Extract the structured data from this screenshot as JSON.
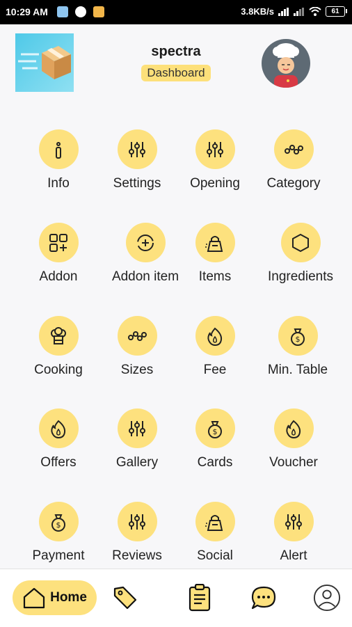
{
  "status_bar": {
    "time": "10:29 AM",
    "network_speed": "3.8KB/s",
    "battery": "61"
  },
  "header": {
    "shop_name": "spectra",
    "badge": "Dashboard",
    "logo_icon": "delivery-box-icon",
    "avatar_icon": "chef-avatar-icon"
  },
  "colors": {
    "accent": "#fde17e",
    "text": "#222222",
    "background": "#f7f7f9"
  },
  "menu": [
    {
      "label": "Info",
      "icon": "info-icon"
    },
    {
      "label": "Settings",
      "icon": "sliders-icon"
    },
    {
      "label": "Opening",
      "icon": "sliders-icon"
    },
    {
      "label": "Category",
      "icon": "nodes-icon"
    },
    {
      "label": "Addon",
      "icon": "grid-plus-icon"
    },
    {
      "label": "Addon item",
      "icon": "dashed-plus-circle-icon"
    },
    {
      "label": "Items",
      "icon": "shopping-bag-icon"
    },
    {
      "label": "Ingredients",
      "icon": "hexagon-icon"
    },
    {
      "label": "Cooking",
      "icon": "chef-hat-icon"
    },
    {
      "label": "Sizes",
      "icon": "nodes-icon"
    },
    {
      "label": "Fee",
      "icon": "flame-icon"
    },
    {
      "label": "Min. Table",
      "icon": "money-bag-icon"
    },
    {
      "label": "Offers",
      "icon": "flame-icon"
    },
    {
      "label": "Gallery",
      "icon": "sliders-icon"
    },
    {
      "label": "Cards",
      "icon": "money-bag-icon"
    },
    {
      "label": "Voucher",
      "icon": "flame-icon"
    },
    {
      "label": "Payment",
      "icon": "money-bag-icon"
    },
    {
      "label": "Reviews",
      "icon": "sliders-icon"
    },
    {
      "label": "Social",
      "icon": "shopping-bag-icon"
    },
    {
      "label": "Alert",
      "icon": "sliders-icon"
    }
  ],
  "bottom_nav": {
    "home_label": "Home",
    "items": [
      "home-icon",
      "tag-icon",
      "clipboard-icon",
      "chat-icon",
      "profile-icon"
    ]
  }
}
